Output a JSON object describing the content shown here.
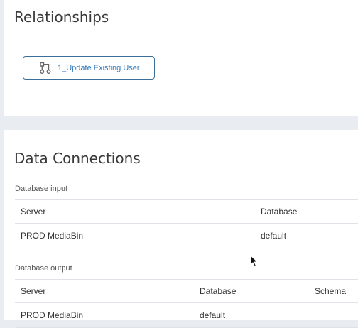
{
  "relationships": {
    "title": "Relationships",
    "items": [
      {
        "label": "1_Update Existing User",
        "icon": "workflow-branch-icon"
      }
    ]
  },
  "data_connections": {
    "title": "Data Connections",
    "database_input": {
      "label": "Database input",
      "columns": [
        "Server",
        "Database"
      ],
      "rows": [
        {
          "server": "PROD MediaBin",
          "database": "default"
        }
      ]
    },
    "database_output": {
      "label": "Database output",
      "columns": [
        "Server",
        "Database",
        "Schema"
      ],
      "rows": [
        {
          "server": "PROD MediaBin",
          "database": "default",
          "schema": ""
        }
      ]
    }
  },
  "colors": {
    "accent": "#2f79b9",
    "button_border": "#3a6f9c",
    "page_background": "#e9edf2"
  }
}
